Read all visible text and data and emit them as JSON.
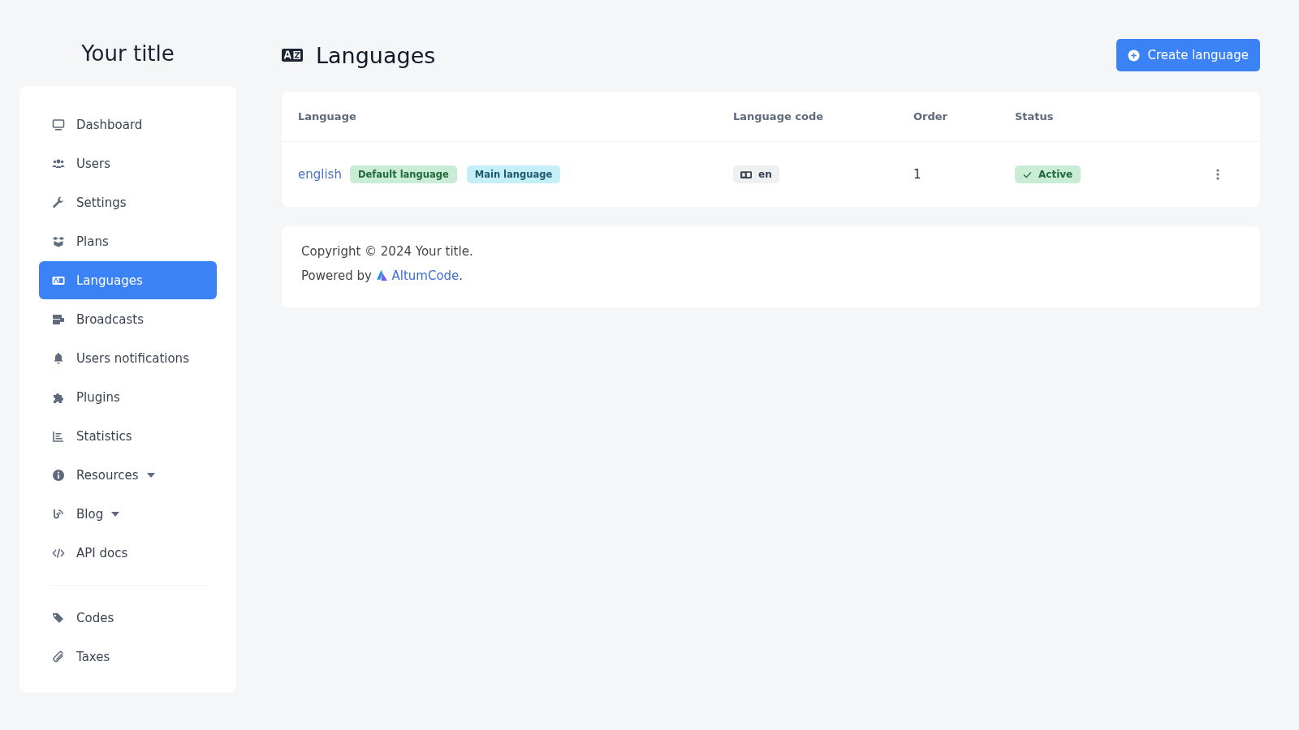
{
  "sidebar": {
    "title": "Your title",
    "sections": [
      {
        "items": [
          {
            "label": "Dashboard",
            "selected": false,
            "has_dropdown": false
          },
          {
            "label": "Users",
            "selected": false,
            "has_dropdown": false
          },
          {
            "label": "Settings",
            "selected": false,
            "has_dropdown": false
          },
          {
            "label": "Plans",
            "selected": false,
            "has_dropdown": false
          },
          {
            "label": "Languages",
            "selected": true,
            "has_dropdown": false
          },
          {
            "label": "Broadcasts",
            "selected": false,
            "has_dropdown": false
          },
          {
            "label": "Users notifications",
            "selected": false,
            "has_dropdown": false
          },
          {
            "label": "Plugins",
            "selected": false,
            "has_dropdown": false
          },
          {
            "label": "Statistics",
            "selected": false,
            "has_dropdown": false
          },
          {
            "label": "Resources",
            "selected": false,
            "has_dropdown": true
          },
          {
            "label": "Blog",
            "selected": false,
            "has_dropdown": true
          },
          {
            "label": "API docs",
            "selected": false,
            "has_dropdown": false
          }
        ]
      },
      {
        "items": [
          {
            "label": "Codes",
            "selected": false,
            "has_dropdown": false
          },
          {
            "label": "Taxes",
            "selected": false,
            "has_dropdown": false
          }
        ]
      }
    ]
  },
  "header": {
    "title": "Languages",
    "create_button": "Create language"
  },
  "table": {
    "columns": [
      "Language",
      "Language code",
      "Order",
      "Status"
    ],
    "rows": [
      {
        "name": "english",
        "badges": [
          {
            "label": "Default language",
            "kind": "default"
          },
          {
            "label": "Main language",
            "kind": "main"
          }
        ],
        "code": "en",
        "order": "1",
        "status": {
          "label": "Active",
          "active": true
        }
      }
    ]
  },
  "footer": {
    "copyright": "Copyright © 2024 Your title.",
    "powered_by": "Powered by",
    "link": "AltumCode",
    "end": "."
  }
}
